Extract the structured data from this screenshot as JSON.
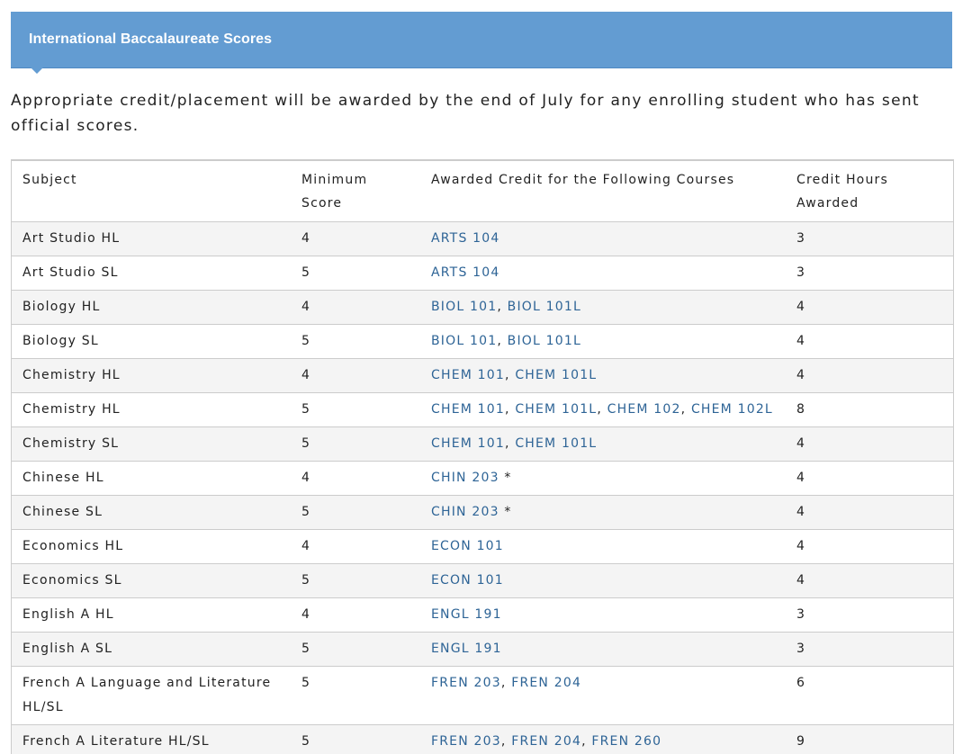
{
  "header": {
    "title": "International Baccalaureate Scores"
  },
  "intro": "Appropriate credit/placement will be awarded by the end of July for any enrolling student who has sent official scores.",
  "table": {
    "columns": [
      "Subject",
      "Minimum Score",
      "Awarded Credit for the Following Courses",
      "Credit Hours Awarded"
    ],
    "rows": [
      {
        "subject": "Art Studio HL",
        "min_score": "4",
        "courses": [
          "ARTS 104"
        ],
        "note": "",
        "hours": "3"
      },
      {
        "subject": "Art Studio SL",
        "min_score": "5",
        "courses": [
          "ARTS 104"
        ],
        "note": "",
        "hours": "3"
      },
      {
        "subject": "Biology HL",
        "min_score": "4",
        "courses": [
          "BIOL 101",
          "BIOL 101L"
        ],
        "note": "",
        "hours": "4"
      },
      {
        "subject": "Biology SL",
        "min_score": "5",
        "courses": [
          "BIOL 101",
          "BIOL 101L"
        ],
        "note": "",
        "hours": "4"
      },
      {
        "subject": "Chemistry HL",
        "min_score": "4",
        "courses": [
          "CHEM 101",
          "CHEM 101L"
        ],
        "note": "",
        "hours": "4"
      },
      {
        "subject": "Chemistry HL",
        "min_score": "5",
        "courses": [
          "CHEM 101",
          "CHEM 101L",
          "CHEM 102",
          "CHEM 102L"
        ],
        "note": "",
        "hours": "8"
      },
      {
        "subject": "Chemistry SL",
        "min_score": "5",
        "courses": [
          "CHEM 101",
          "CHEM 101L"
        ],
        "note": "",
        "hours": "4"
      },
      {
        "subject": "Chinese HL",
        "min_score": "4",
        "courses": [
          "CHIN 203"
        ],
        "note": "*",
        "hours": "4"
      },
      {
        "subject": "Chinese SL",
        "min_score": "5",
        "courses": [
          "CHIN 203"
        ],
        "note": "*",
        "hours": "4"
      },
      {
        "subject": "Economics HL",
        "min_score": "4",
        "courses": [
          "ECON 101"
        ],
        "note": "",
        "hours": "4"
      },
      {
        "subject": "Economics SL",
        "min_score": "5",
        "courses": [
          "ECON 101"
        ],
        "note": "",
        "hours": "4"
      },
      {
        "subject": "English A HL",
        "min_score": "4",
        "courses": [
          "ENGL 191"
        ],
        "note": "",
        "hours": "3"
      },
      {
        "subject": "English A SL",
        "min_score": "5",
        "courses": [
          "ENGL 191"
        ],
        "note": "",
        "hours": "3"
      },
      {
        "subject": "French A Language and Literature HL/SL",
        "min_score": "5",
        "courses": [
          "FREN 203",
          "FREN 204"
        ],
        "note": "",
        "hours": "6"
      },
      {
        "subject": "French A Literature HL/SL",
        "min_score": "5",
        "courses": [
          "FREN 203",
          "FREN 204",
          "FREN 260"
        ],
        "note": "",
        "hours": "9"
      }
    ]
  },
  "colors": {
    "banner": "#639cd2",
    "link": "#2e6496",
    "stripe": "#f4f4f4",
    "border": "#cccccc"
  }
}
